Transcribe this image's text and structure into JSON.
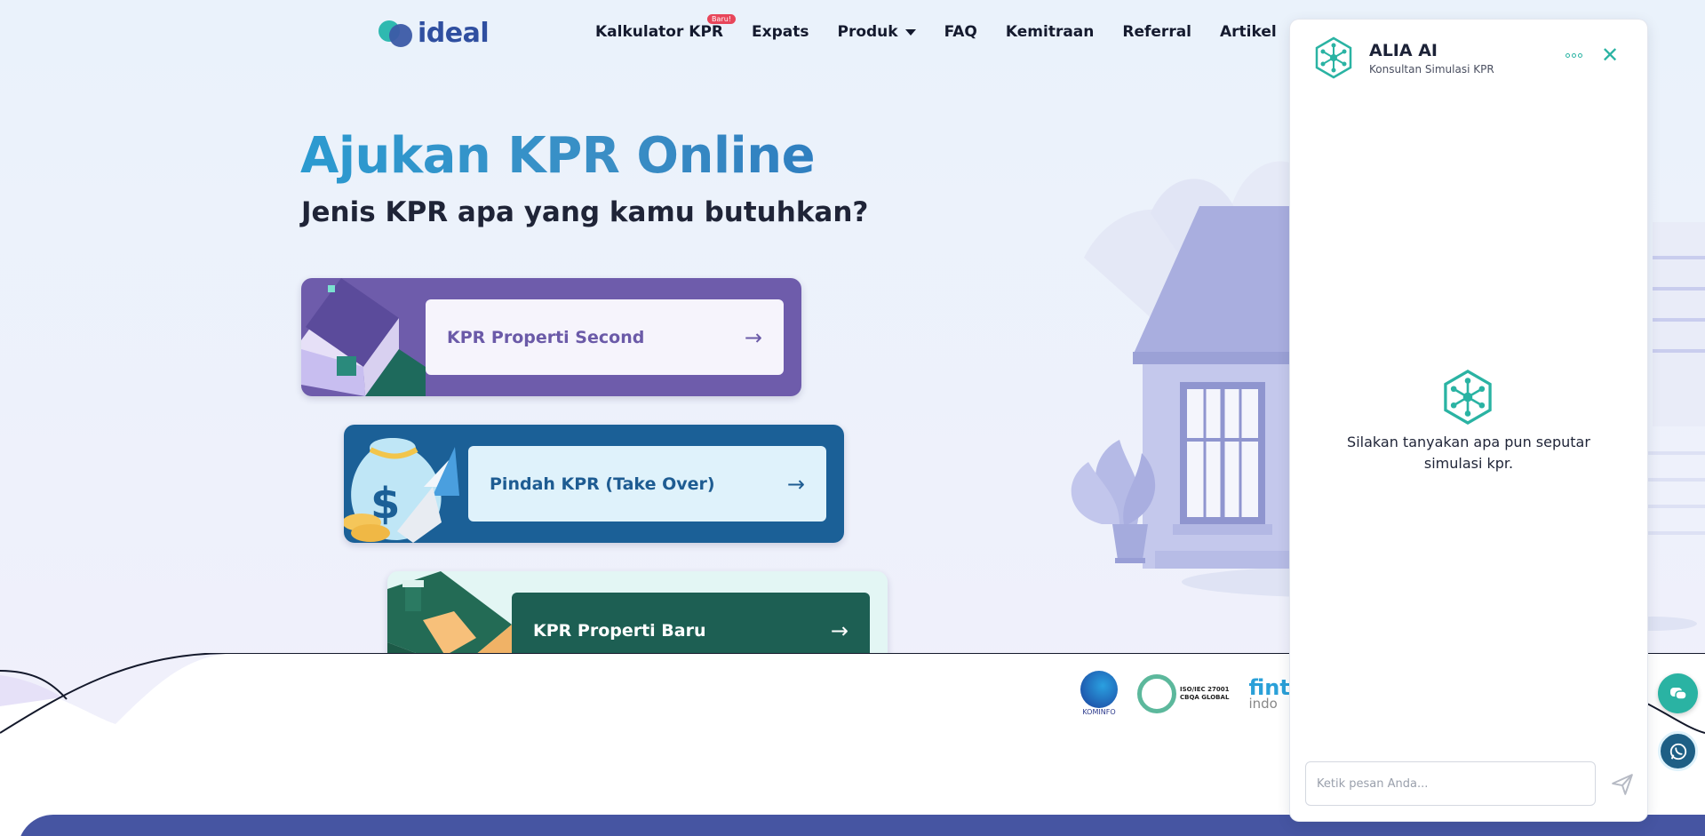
{
  "header": {
    "logo_text": "ideal",
    "nav": [
      {
        "label": "Kalkulator KPR",
        "badge": "Baru!"
      },
      {
        "label": "Expats"
      },
      {
        "label": "Produk",
        "dropdown": true
      },
      {
        "label": "FAQ"
      },
      {
        "label": "Kemitraan"
      },
      {
        "label": "Referral"
      },
      {
        "label": "Artikel"
      }
    ]
  },
  "hero": {
    "title": "Ajukan KPR Online",
    "subtitle": "Jenis KPR apa yang kamu butuhkan?",
    "options": [
      {
        "label": "KPR Properti Second"
      },
      {
        "label": "Pindah KPR (Take Over)"
      },
      {
        "label": "KPR Properti Baru"
      }
    ]
  },
  "certs": {
    "kominfo": "KOMINFO",
    "iso_line1": "ISO/IEC 27001",
    "iso_line2": "CBQA GLOBAL",
    "fintech_line1": "fint",
    "fintech_line2": "indo"
  },
  "chat": {
    "title": "ALIA AI",
    "subtitle": "Konsultan Simulasi KPR",
    "empty_message": "Silakan tanyakan apa pun seputar simulasi kpr.",
    "input_placeholder": "Ketik pesan Anda..."
  },
  "colors": {
    "primary_teal": "#2ab3a3",
    "second_card": "#6e5cab",
    "takeover_card": "#1b6097",
    "baru_card": "#1d5f53",
    "bottom_band": "#4655a2"
  }
}
